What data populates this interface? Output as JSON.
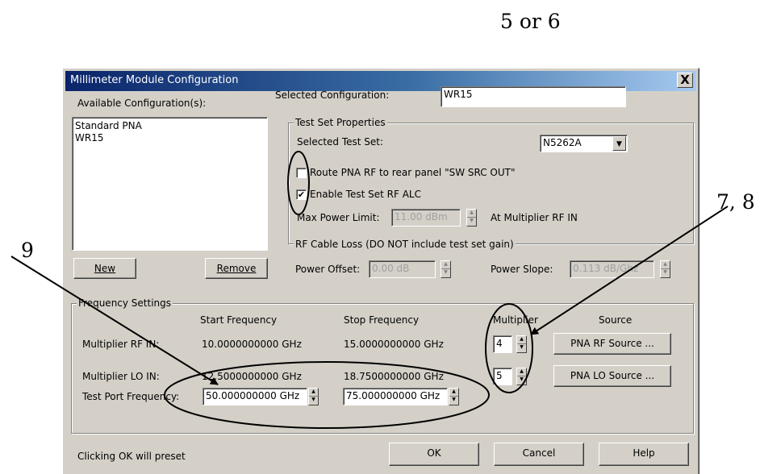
{
  "callouts": {
    "c56": "5 or 6",
    "c78": "7, 8",
    "c9": "9"
  },
  "dialog": {
    "title": "Millimeter Module Configuration",
    "close": "X",
    "available_label": "Available Configuration(s):",
    "configurations": [
      "Standard PNA",
      "WR15"
    ],
    "new_label": "New",
    "remove_label": "Remove",
    "selected_config_label": "Selected Configuration:",
    "selected_config_value": "WR15",
    "test_set": {
      "group_title": "Test Set Properties",
      "selected_label": "Selected Test Set:",
      "selected_value": "N5262A",
      "route_label": "Route PNA RF to rear panel \"SW SRC OUT\"",
      "route_checked": false,
      "alc_label": "Enable Test Set RF ALC",
      "alc_checked": true,
      "max_power_label": "Max Power Limit:",
      "max_power_value": "11.00 dBm",
      "max_power_suffix": "At Multiplier RF IN"
    },
    "cable_loss": {
      "group_title": "RF Cable Loss (DO NOT include test set gain)",
      "offset_label": "Power Offset:",
      "offset_value": "0.00 dB",
      "slope_label": "Power Slope:",
      "slope_value": "0.113 dB/Ghz"
    },
    "frequency": {
      "group_title": "Frequency Settings",
      "col_start": "Start Frequency",
      "col_stop": "Stop Frequency",
      "col_mult": "Multiplier",
      "col_source": "Source",
      "rf_in_label": "Multiplier RF IN:",
      "rf_in_start": "10.0000000000 GHz",
      "rf_in_stop": "15.0000000000 GHz",
      "rf_mult": "4",
      "rf_source_btn": "PNA RF Source ...",
      "lo_in_label": "Multiplier LO IN:",
      "lo_in_start": "12.5000000000 GHz",
      "lo_in_stop": "18.7500000000 GHz",
      "lo_mult": "5",
      "lo_source_btn": "PNA LO Source ...",
      "tp_label": "Test Port Frequency:",
      "tp_start": "50.000000000 GHz",
      "tp_stop": "75.000000000 GHz"
    },
    "footer_note": "Clicking OK will preset",
    "ok_label": "OK",
    "cancel_label": "Cancel",
    "help_label": "Help"
  }
}
